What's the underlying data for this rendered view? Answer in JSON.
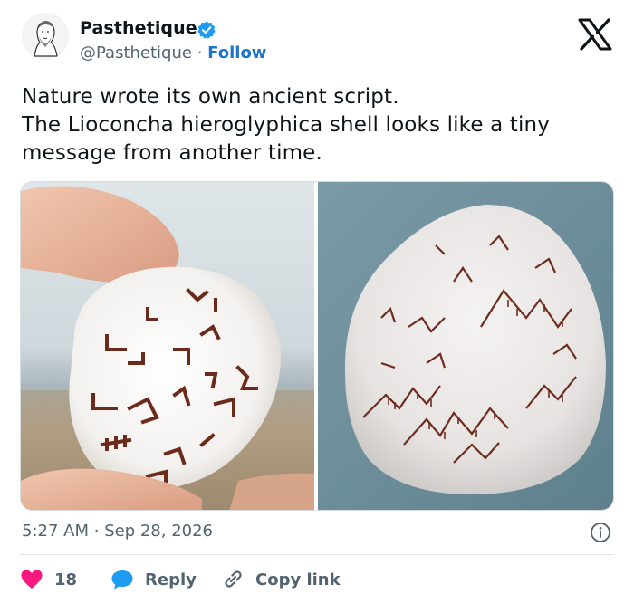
{
  "author": {
    "display_name": "Pasthetique",
    "handle": "@Pasthetique",
    "separator": "·",
    "follow_label": "Follow",
    "verified": true
  },
  "tweet": {
    "lines": [
      "Nature wrote its own ancient script.",
      "The Lioconcha hieroglyphica shell looks like a tiny",
      "message from another time."
    ]
  },
  "media": {
    "left_image": "hand-holding-shell-photo",
    "right_image": "shell-closeup-photo"
  },
  "meta": {
    "time": "5:27 AM",
    "separator": "·",
    "date": "Sep 28, 2026"
  },
  "actions": {
    "like_count": "18",
    "reply_label": "Reply",
    "copy_link_label": "Copy link"
  },
  "colors": {
    "like": "#f91880",
    "reply": "#1d9bf0",
    "follow": "#1d74c9",
    "secondary_text": "#536471",
    "verified": "#1d9bf0"
  },
  "icons": [
    "avatar-bust",
    "verified-badge-icon",
    "x-logo-icon",
    "heart-icon",
    "reply-bubble-icon",
    "link-icon",
    "info-icon"
  ]
}
